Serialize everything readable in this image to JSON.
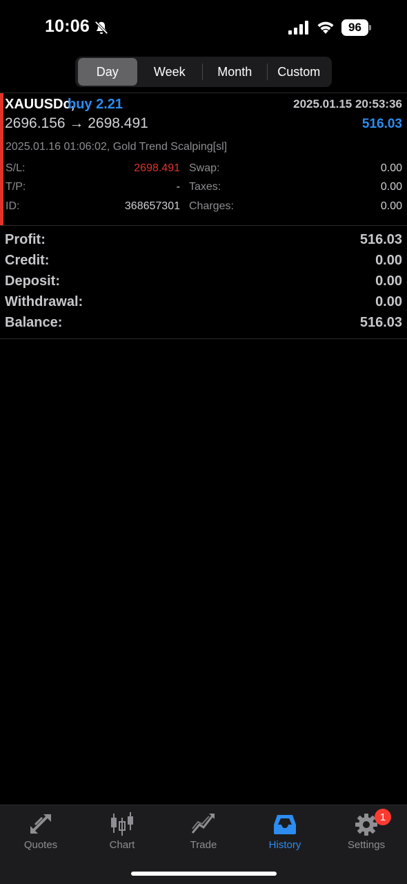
{
  "status_bar": {
    "time": "10:06",
    "battery": "96",
    "icons": [
      "bell-slash-icon",
      "signal-icon",
      "wifi-icon",
      "battery-icon"
    ]
  },
  "period_tabs": {
    "items": [
      {
        "label": "Day",
        "selected": true
      },
      {
        "label": "Week",
        "selected": false
      },
      {
        "label": "Month",
        "selected": false
      },
      {
        "label": "Custom",
        "selected": false
      }
    ]
  },
  "deal": {
    "symbol": "XAUUSDc,",
    "type": "buy 2.21",
    "open_time": "2025.01.15 20:53:36",
    "prices": "2696.156 → 2698.491",
    "profit": "516.03",
    "close_info": "2025.01.16 01:06:02, Gold Trend Scalping[sl]",
    "fields": {
      "sl_label": "S/L:",
      "sl_value": "2698.491",
      "tp_label": "T/P:",
      "tp_value": "-",
      "id_label": "ID:",
      "id_value": "368657301",
      "swap_label": "Swap:",
      "swap_value": "0.00",
      "taxes_label": "Taxes:",
      "taxes_value": "0.00",
      "charges_label": "Charges:",
      "charges_value": "0.00"
    }
  },
  "summary": {
    "rows": [
      {
        "label": "Profit:",
        "value": "516.03"
      },
      {
        "label": "Credit:",
        "value": "0.00"
      },
      {
        "label": "Deposit:",
        "value": "0.00"
      },
      {
        "label": "Withdrawal:",
        "value": "0.00"
      },
      {
        "label": "Balance:",
        "value": "516.03"
      }
    ]
  },
  "tab_bar": {
    "items": [
      {
        "label": "Quotes",
        "icon": "quotes-arrows-icon",
        "active": false
      },
      {
        "label": "Chart",
        "icon": "candlestick-chart-icon",
        "active": false
      },
      {
        "label": "Trade",
        "icon": "trend-line-icon",
        "active": false
      },
      {
        "label": "History",
        "icon": "inbox-tray-icon",
        "active": true
      },
      {
        "label": "Settings",
        "icon": "gear-icon",
        "active": false,
        "badge": "1"
      }
    ]
  },
  "colors": {
    "accent_blue": "#2d8cf0",
    "loss_red": "#e0342b",
    "background": "#000000"
  }
}
